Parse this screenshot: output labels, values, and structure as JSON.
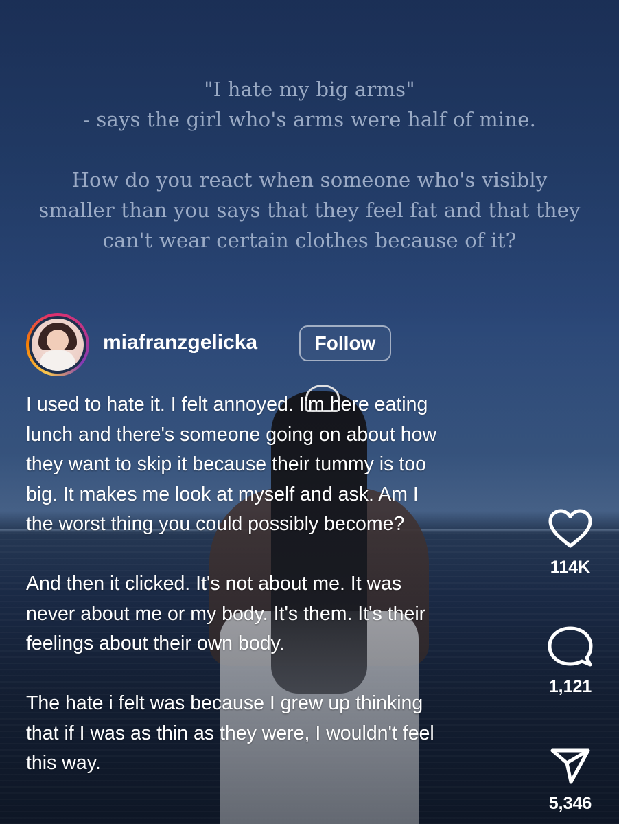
{
  "quote": {
    "lines": [
      "\"I hate my big arms\"",
      "- says the girl who's arms were half of mine.",
      "",
      "How do you react when someone who's visibly",
      "smaller than you says that they feel fat and that they",
      "can't wear certain clothes because of it?"
    ]
  },
  "post": {
    "username": "miafranzgelicka",
    "follow_label": "Follow"
  },
  "caption": {
    "lines": [
      "I used to hate it. I felt annoyed. I'm here eating",
      "lunch and there's someone going on about how",
      "they want to skip it because their tummy is too",
      "big. It makes me look at myself and ask. Am I",
      "the worst thing you could possibly become?",
      "",
      "And then it clicked. It's not about me. It was",
      "never about me or my body. It's them. It's their",
      "feelings about their own body.",
      "",
      "The hate i felt was because I grew up thinking",
      "that if I was as thin as they were, I wouldn't feel",
      "this way."
    ]
  },
  "actions": {
    "like": {
      "icon": "heart-icon",
      "count": "114K"
    },
    "comment": {
      "icon": "comment-bubble-icon",
      "count": "1,121"
    },
    "share": {
      "icon": "paper-plane-icon",
      "count": "5,346"
    }
  }
}
